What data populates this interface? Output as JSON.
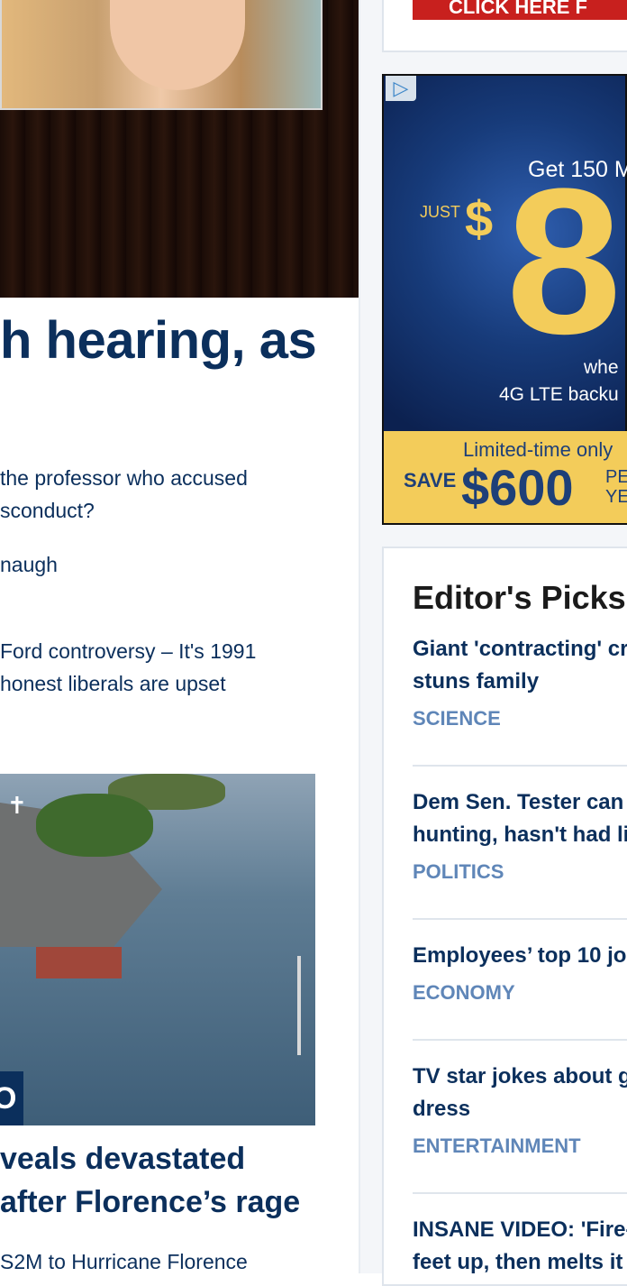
{
  "main_story": {
    "headline": "h hearing, as",
    "related": [
      "the professor who accused",
      "sconduct?",
      "naugh",
      "Ford controversy – It's 1991",
      "honest liberals are upset"
    ]
  },
  "second_story": {
    "badge": "O",
    "title_lines": [
      "veals devastated",
      "after Florence’s rage"
    ],
    "subtitle": "S2M to Hurricane Florence"
  },
  "sidebar": {
    "cta_label": "CLICK HERE F",
    "ad": {
      "headline": "Get 150 M",
      "just": "JUST",
      "dollar": "$",
      "price": "8",
      "when": "whe",
      "lte": "4G LTE backu",
      "limited": "Limited-time only",
      "save": "SAVE",
      "save_amount": "$600",
      "per1": "PE",
      "per2": "YE"
    },
    "editors_picks": {
      "title": "Editor's Picks",
      "items": [
        {
          "lines": [
            "Giant 'contracting' cr",
            "stuns family"
          ],
          "category": "SCIENCE"
        },
        {
          "lines": [
            "Dem Sen. Tester can",
            "hunting, hasn't had li"
          ],
          "category": "POLITICS"
        },
        {
          "lines": [
            "Employees’ top 10 jo"
          ],
          "category": "ECONOMY"
        },
        {
          "lines": [
            "TV star jokes about g",
            "dress"
          ],
          "category": "ENTERTAINMENT"
        },
        {
          "lines": [
            "INSANE VIDEO: 'Fire-",
            "feet up, then melts it"
          ],
          "category": ""
        }
      ]
    }
  },
  "colors": {
    "navy": "#0b2f5c",
    "category_blue": "#5f86b8",
    "cta_red": "#c8201e",
    "ad_yellow": "#f3cc5a"
  }
}
